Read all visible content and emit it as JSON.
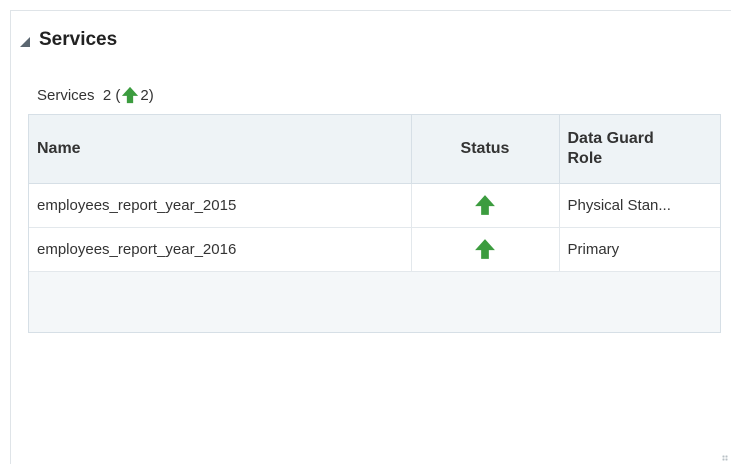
{
  "panel": {
    "title": "Services",
    "summary_prefix": "Services  2 (",
    "summary_count": "2",
    "summary_suffix": ")"
  },
  "table": {
    "columns": [
      "Name",
      "Status",
      "Data Guard Role"
    ],
    "rows": [
      {
        "name": "employees_report_year_2015",
        "status": "up-arrow-icon",
        "role": "Physical Stan..."
      },
      {
        "name": "employees_report_year_2016",
        "status": "up-arrow-icon",
        "role": "Primary"
      }
    ]
  },
  "colors": {
    "status_up": "#3c9c3f",
    "header_bg": "#eef3f6",
    "border": "#d6dfe6"
  }
}
